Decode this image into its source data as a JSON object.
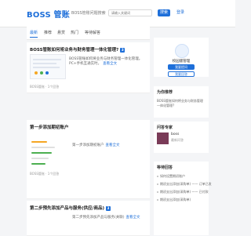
{
  "header": {
    "logo": "BOSS 管账",
    "nav_text": "BOSS管账问题搜索",
    "search_placeholder": "请输入关键词",
    "search_button": "搜索",
    "login_button": "登录"
  },
  "tabs": [
    {
      "label": "最新",
      "active": true
    },
    {
      "label": "推荐",
      "active": false
    },
    {
      "label": "悬赏",
      "active": false
    },
    {
      "label": "热门",
      "active": false
    },
    {
      "label": "等待解答",
      "active": false
    }
  ],
  "posts": [
    {
      "title": "BOSS管账如何将业务与财务管理一体化管理?",
      "badge": "3",
      "text": "BOSS管账如何将业务与财务管理一体化管理。PC+手机互通实时。",
      "more": "查看全文",
      "meta": "BOSS管账  ·  1个回答"
    },
    {
      "title": "第一步添加期初账户",
      "badge": "",
      "text": "第一步添加期初账户",
      "more": "查看全文",
      "meta": "BOSS管账  ·  1个回答"
    },
    {
      "title": "第二步预先添加产品与服务(供应/商品)",
      "badge": "3",
      "text": "第二步预先添加产品与服务(关联)",
      "more": "查看全文",
      "meta": ""
    }
  ],
  "sidebar": {
    "brand_panel": {
      "name": "校园版管理",
      "button_primary": "我要提问",
      "button_secondary": "我要回答"
    },
    "related": {
      "title": "为你推荐",
      "link": "BOSS管账如何将业务与财务管理一体化管理?"
    },
    "qa": {
      "title": "问答专家",
      "name": "boss",
      "sub": "最新问答"
    },
    "list": {
      "title": "等待回答",
      "items": [
        "如何设置期初账户",
        "期初支出添加(采购单) —— 订单已发",
        "期初支出添加(采购单) —— 已付款",
        "期初支出添加(采购单)"
      ]
    }
  },
  "colors": {
    "accent": "#1e6fd9",
    "background": "#f4f5f7"
  }
}
